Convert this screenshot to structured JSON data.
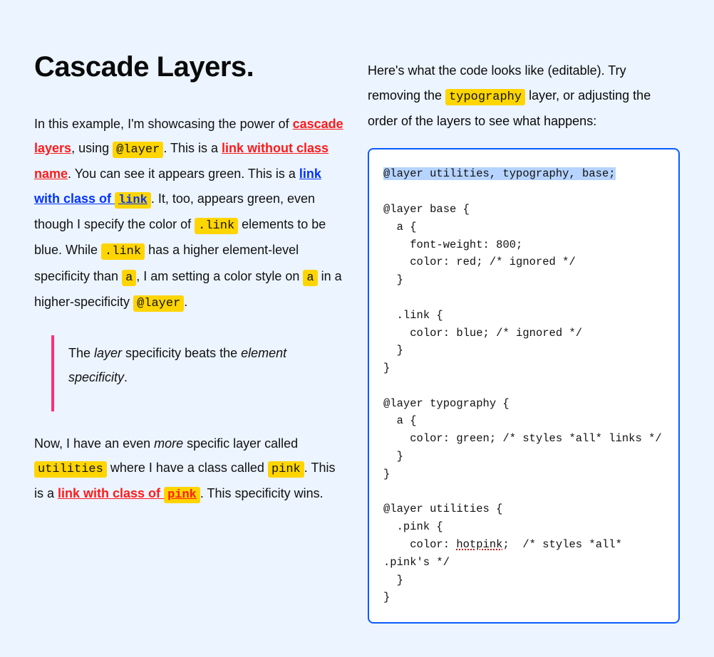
{
  "heading": "Cascade Layers.",
  "left": {
    "p1": {
      "t1": "In this example, I'm showcasing the power of ",
      "link_cascade": "cascade layers",
      "t2": ", using ",
      "code_at_layer": "@layer",
      "t3": ". This is a ",
      "link_no_class": "link without class name",
      "t4": ". You can see it appears green. This is a ",
      "link_with_link_pre": "link with class of ",
      "link_with_link_code": "link",
      "t5": ". It, too, appears green, even though I specify the color of ",
      "code_dot_link_1": ".link",
      "t6": " elements to be blue. While ",
      "code_dot_link_2": ".link",
      "t7": " has a higher element-level specificity than ",
      "code_a_1": "a",
      "t8": ", I am setting a color style on ",
      "code_a_2": "a",
      "t9": " in a higher-specificity ",
      "code_at_layer_2": "@layer",
      "t10": "."
    },
    "bq": {
      "t1": "The ",
      "em1": "layer",
      "t2": " specificity beats the ",
      "em2": "element specificity",
      "t3": "."
    },
    "p2": {
      "t1": "Now, I have an even ",
      "em_more": "more",
      "t2": " specific layer called ",
      "code_utilities": "utilities",
      "t3": " where I have a class called ",
      "code_pink_1": "pink",
      "t4": ". This is a ",
      "link_with_pink_pre": "link with class of ",
      "link_with_pink_code": "pink",
      "t5": ". This specificity wins."
    }
  },
  "right": {
    "intro": {
      "t1": "Here's what the code looks like (editable). Try removing the ",
      "code_typography": "typography",
      "t2": " layer, or adjusting the order of the layers to see what happens:"
    },
    "code": {
      "sel_line": "@layer utilities, typography, base;",
      "l02": "",
      "l03": "@layer base {",
      "l04": "  a {",
      "l05": "    font-weight: 800;",
      "l06": "    color: red; /* ignored */",
      "l07": "  }",
      "l08": "",
      "l09": "  .link {",
      "l10": "    color: blue; /* ignored */",
      "l11": "  }",
      "l12": "}",
      "l13": "",
      "l14": "@layer typography {",
      "l15": "  a {",
      "l16": "    color: green; /* styles *all* links */",
      "l17": "  }",
      "l18": "}",
      "l19": "",
      "l20": "@layer utilities {",
      "l21": "  .pink {",
      "l22a": "    color: ",
      "l22_hotpink": "hotpink",
      "l22b": ";  /* styles *all* .pink's */",
      "l23": "  }",
      "l24": "}"
    }
  }
}
